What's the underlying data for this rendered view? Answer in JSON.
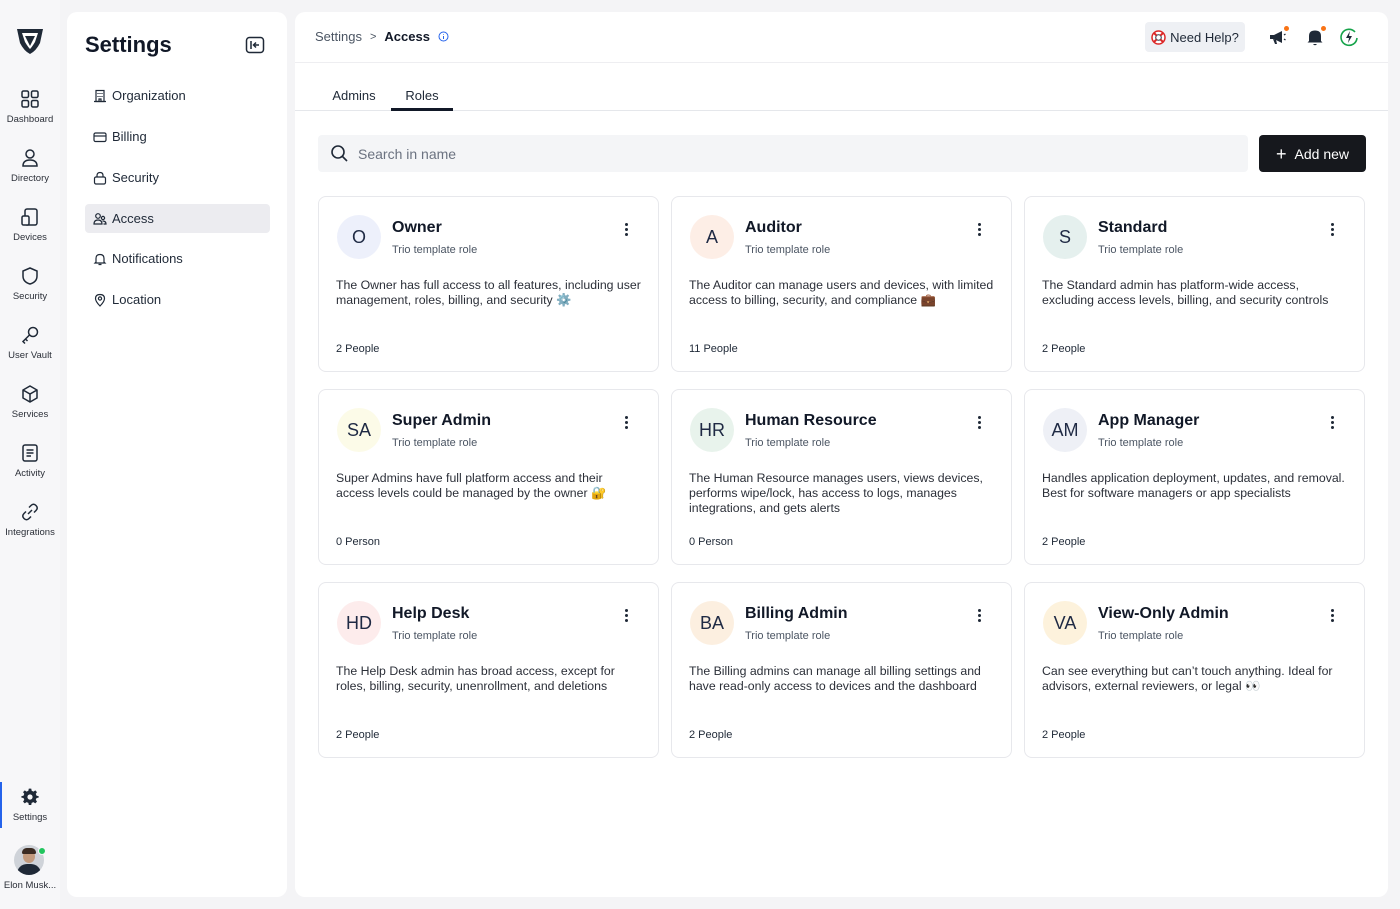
{
  "rail": {
    "items": [
      {
        "label": "Dashboard",
        "icon": "dashboard-icon"
      },
      {
        "label": "Directory",
        "icon": "user-icon"
      },
      {
        "label": "Devices",
        "icon": "devices-icon"
      },
      {
        "label": "Security",
        "icon": "shield-icon"
      },
      {
        "label": "User Vault",
        "icon": "key-icon"
      },
      {
        "label": "Services",
        "icon": "cube-icon"
      },
      {
        "label": "Activity",
        "icon": "document-icon"
      },
      {
        "label": "Integrations",
        "icon": "link-icon"
      }
    ],
    "settings_label": "Settings",
    "user_name": "Elon Musk..."
  },
  "panel": {
    "title": "Settings",
    "menu": [
      {
        "label": "Organization",
        "icon": "building-icon"
      },
      {
        "label": "Billing",
        "icon": "credit-card-icon"
      },
      {
        "label": "Security",
        "icon": "lock-icon"
      },
      {
        "label": "Access",
        "icon": "users-icon"
      },
      {
        "label": "Notifications",
        "icon": "bell-icon"
      },
      {
        "label": "Location",
        "icon": "location-pin-icon"
      }
    ],
    "active": "Access"
  },
  "header": {
    "breadcrumb": [
      "Settings",
      "Access"
    ],
    "help_label": "Need Help?"
  },
  "tabs": [
    "Admins",
    "Roles"
  ],
  "active_tab": "Roles",
  "search": {
    "placeholder": "Search in name"
  },
  "add_button": "Add new",
  "roles": [
    {
      "initials": "O",
      "name": "Owner",
      "subtitle": "Trio template role",
      "description": "The Owner has full access to all features, including user management, roles, billing, and security ⚙️",
      "people": "2 People",
      "color": "#edf0fb"
    },
    {
      "initials": "A",
      "name": "Auditor",
      "subtitle": "Trio template role",
      "description": "The Auditor can manage users and devices, with limited access to billing, security, and compliance 💼",
      "people": "11 People",
      "color": "#fdeee6"
    },
    {
      "initials": "S",
      "name": "Standard",
      "subtitle": "Trio template role",
      "description": "The Standard admin has platform-wide access, excluding access levels, billing, and security controls",
      "people": "2 People",
      "color": "#e5f0ee"
    },
    {
      "initials": "SA",
      "name": "Super Admin",
      "subtitle": "Trio template role",
      "description": "Super Admins have full platform access and their access levels could be managed by the owner 🔐",
      "people": "0 Person",
      "color": "#fcfbe8"
    },
    {
      "initials": "HR",
      "name": "Human Resource",
      "subtitle": "Trio template role",
      "description": "The Human Resource manages users, views devices, performs wipe/lock, has access to logs, manages integrations, and gets alerts",
      "people": "0 Person",
      "color": "#e8f3ec"
    },
    {
      "initials": "AM",
      "name": "App Manager",
      "subtitle": "Trio template role",
      "description": "Handles application deployment, updates, and removal. Best for software managers or app specialists",
      "people": "2 People",
      "color": "#eef0f6"
    },
    {
      "initials": "HD",
      "name": "Help Desk",
      "subtitle": "Trio template role",
      "description": "The Help Desk admin has broad access, except for roles, billing, security, unenrollment, and deletions",
      "people": "2 People",
      "color": "#fdecec"
    },
    {
      "initials": "BA",
      "name": "Billing Admin",
      "subtitle": "Trio template role",
      "description": "The Billing admins can manage all billing settings and have read-only access to devices and the dashboard",
      "people": "2 People",
      "color": "#fcefe0"
    },
    {
      "initials": "VA",
      "name": "View-Only Admin",
      "subtitle": "Trio template role",
      "description": "Can see everything but can’t touch anything. Ideal for advisors, external reviewers, or legal 👀",
      "people": "2 People",
      "color": "#fdf2dc"
    }
  ]
}
